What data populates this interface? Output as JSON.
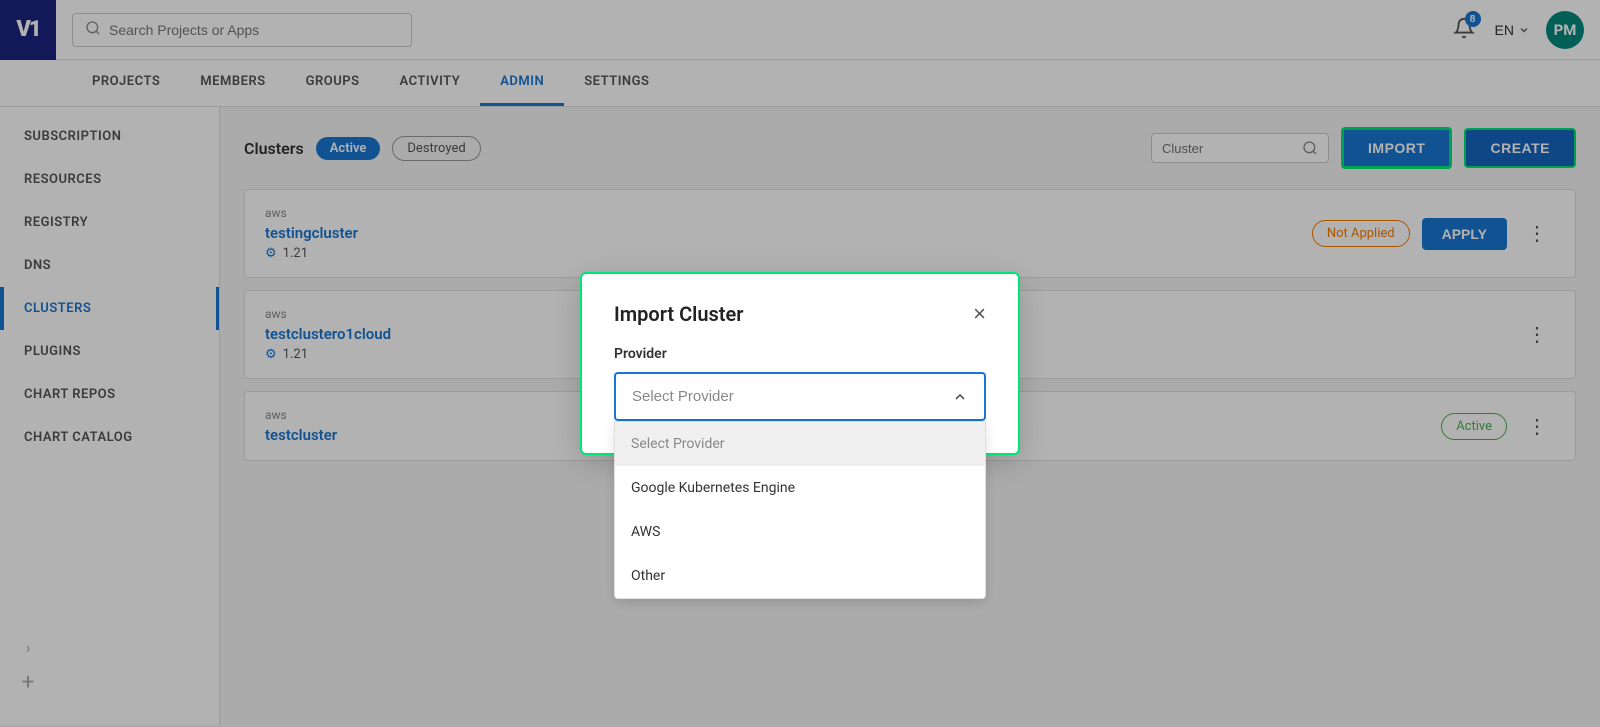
{
  "topbar": {
    "logo": "V1",
    "search_placeholder": "Search Projects or Apps",
    "notification_count": "8",
    "lang": "EN",
    "avatar_initials": "PM"
  },
  "nav_tabs": [
    {
      "label": "PROJECTS",
      "active": false
    },
    {
      "label": "MEMBERS",
      "active": false
    },
    {
      "label": "GROUPS",
      "active": false
    },
    {
      "label": "ACTIVITY",
      "active": false
    },
    {
      "label": "ADMIN",
      "active": true
    },
    {
      "label": "SETTINGS",
      "active": false
    }
  ],
  "sidebar": {
    "items": [
      {
        "label": "SUBSCRIPTION",
        "active": false
      },
      {
        "label": "RESOURCES",
        "active": false
      },
      {
        "label": "REGISTRY",
        "active": false
      },
      {
        "label": "DNS",
        "active": false
      },
      {
        "label": "CLUSTERS",
        "active": true
      },
      {
        "label": "PLUGINS",
        "active": false
      },
      {
        "label": "CHART REPOS",
        "active": false
      },
      {
        "label": "CHART CATALOG",
        "active": false
      }
    ]
  },
  "clusters_header": {
    "title": "Clusters",
    "badge_active": "Active",
    "badge_destroyed": "Destroyed",
    "search_placeholder": "Cluster",
    "btn_import": "IMPORT",
    "btn_create": "CREATE"
  },
  "clusters": [
    {
      "provider": "aws",
      "name": "testingcluster",
      "version": "1.21",
      "status": "Not Applied",
      "btn_apply": "APPLY"
    },
    {
      "provider": "aws",
      "name": "testclustero1cloud",
      "version": "1.21",
      "status": "",
      "btn_apply": ""
    },
    {
      "provider": "aws",
      "name": "testcluster",
      "version": "",
      "status": "Active",
      "btn_apply": ""
    }
  ],
  "modal": {
    "title": "Import Cluster",
    "close_label": "×",
    "provider_label": "Provider",
    "select_placeholder": "Select Provider",
    "dropdown_items": [
      {
        "label": "Select Provider",
        "selected": true
      },
      {
        "label": "Google Kubernetes Engine",
        "selected": false
      },
      {
        "label": "AWS",
        "selected": false
      },
      {
        "label": "Other",
        "selected": false
      }
    ]
  },
  "sidebar_plus": "+",
  "sidebar_expand": "›"
}
